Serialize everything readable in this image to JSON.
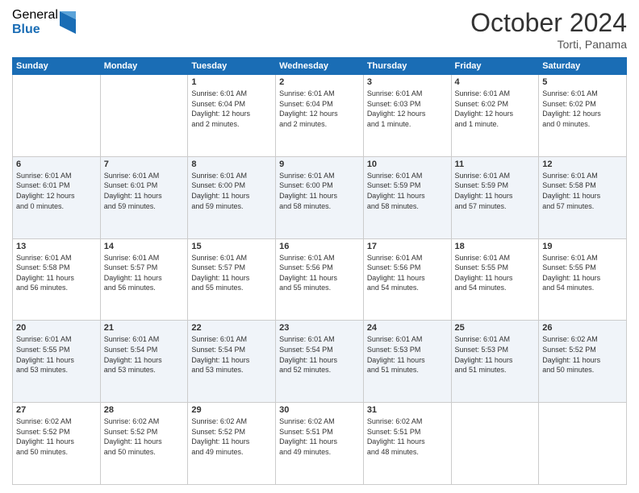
{
  "header": {
    "logo_general": "General",
    "logo_blue": "Blue",
    "month_title": "October 2024",
    "location": "Torti, Panama"
  },
  "days_of_week": [
    "Sunday",
    "Monday",
    "Tuesday",
    "Wednesday",
    "Thursday",
    "Friday",
    "Saturday"
  ],
  "weeks": [
    [
      {
        "day": "",
        "empty": true
      },
      {
        "day": "",
        "empty": true
      },
      {
        "day": "1",
        "info": "Sunrise: 6:01 AM\nSunset: 6:04 PM\nDaylight: 12 hours\nand 2 minutes."
      },
      {
        "day": "2",
        "info": "Sunrise: 6:01 AM\nSunset: 6:04 PM\nDaylight: 12 hours\nand 2 minutes."
      },
      {
        "day": "3",
        "info": "Sunrise: 6:01 AM\nSunset: 6:03 PM\nDaylight: 12 hours\nand 1 minute."
      },
      {
        "day": "4",
        "info": "Sunrise: 6:01 AM\nSunset: 6:02 PM\nDaylight: 12 hours\nand 1 minute."
      },
      {
        "day": "5",
        "info": "Sunrise: 6:01 AM\nSunset: 6:02 PM\nDaylight: 12 hours\nand 0 minutes."
      }
    ],
    [
      {
        "day": "6",
        "info": "Sunrise: 6:01 AM\nSunset: 6:01 PM\nDaylight: 12 hours\nand 0 minutes."
      },
      {
        "day": "7",
        "info": "Sunrise: 6:01 AM\nSunset: 6:01 PM\nDaylight: 11 hours\nand 59 minutes."
      },
      {
        "day": "8",
        "info": "Sunrise: 6:01 AM\nSunset: 6:00 PM\nDaylight: 11 hours\nand 59 minutes."
      },
      {
        "day": "9",
        "info": "Sunrise: 6:01 AM\nSunset: 6:00 PM\nDaylight: 11 hours\nand 58 minutes."
      },
      {
        "day": "10",
        "info": "Sunrise: 6:01 AM\nSunset: 5:59 PM\nDaylight: 11 hours\nand 58 minutes."
      },
      {
        "day": "11",
        "info": "Sunrise: 6:01 AM\nSunset: 5:59 PM\nDaylight: 11 hours\nand 57 minutes."
      },
      {
        "day": "12",
        "info": "Sunrise: 6:01 AM\nSunset: 5:58 PM\nDaylight: 11 hours\nand 57 minutes."
      }
    ],
    [
      {
        "day": "13",
        "info": "Sunrise: 6:01 AM\nSunset: 5:58 PM\nDaylight: 11 hours\nand 56 minutes."
      },
      {
        "day": "14",
        "info": "Sunrise: 6:01 AM\nSunset: 5:57 PM\nDaylight: 11 hours\nand 56 minutes."
      },
      {
        "day": "15",
        "info": "Sunrise: 6:01 AM\nSunset: 5:57 PM\nDaylight: 11 hours\nand 55 minutes."
      },
      {
        "day": "16",
        "info": "Sunrise: 6:01 AM\nSunset: 5:56 PM\nDaylight: 11 hours\nand 55 minutes."
      },
      {
        "day": "17",
        "info": "Sunrise: 6:01 AM\nSunset: 5:56 PM\nDaylight: 11 hours\nand 54 minutes."
      },
      {
        "day": "18",
        "info": "Sunrise: 6:01 AM\nSunset: 5:55 PM\nDaylight: 11 hours\nand 54 minutes."
      },
      {
        "day": "19",
        "info": "Sunrise: 6:01 AM\nSunset: 5:55 PM\nDaylight: 11 hours\nand 54 minutes."
      }
    ],
    [
      {
        "day": "20",
        "info": "Sunrise: 6:01 AM\nSunset: 5:55 PM\nDaylight: 11 hours\nand 53 minutes."
      },
      {
        "day": "21",
        "info": "Sunrise: 6:01 AM\nSunset: 5:54 PM\nDaylight: 11 hours\nand 53 minutes."
      },
      {
        "day": "22",
        "info": "Sunrise: 6:01 AM\nSunset: 5:54 PM\nDaylight: 11 hours\nand 53 minutes."
      },
      {
        "day": "23",
        "info": "Sunrise: 6:01 AM\nSunset: 5:54 PM\nDaylight: 11 hours\nand 52 minutes."
      },
      {
        "day": "24",
        "info": "Sunrise: 6:01 AM\nSunset: 5:53 PM\nDaylight: 11 hours\nand 51 minutes."
      },
      {
        "day": "25",
        "info": "Sunrise: 6:01 AM\nSunset: 5:53 PM\nDaylight: 11 hours\nand 51 minutes."
      },
      {
        "day": "26",
        "info": "Sunrise: 6:02 AM\nSunset: 5:52 PM\nDaylight: 11 hours\nand 50 minutes."
      }
    ],
    [
      {
        "day": "27",
        "info": "Sunrise: 6:02 AM\nSunset: 5:52 PM\nDaylight: 11 hours\nand 50 minutes."
      },
      {
        "day": "28",
        "info": "Sunrise: 6:02 AM\nSunset: 5:52 PM\nDaylight: 11 hours\nand 50 minutes."
      },
      {
        "day": "29",
        "info": "Sunrise: 6:02 AM\nSunset: 5:52 PM\nDaylight: 11 hours\nand 49 minutes."
      },
      {
        "day": "30",
        "info": "Sunrise: 6:02 AM\nSunset: 5:51 PM\nDaylight: 11 hours\nand 49 minutes."
      },
      {
        "day": "31",
        "info": "Sunrise: 6:02 AM\nSunset: 5:51 PM\nDaylight: 11 hours\nand 48 minutes."
      },
      {
        "day": "",
        "empty": true
      },
      {
        "day": "",
        "empty": true
      }
    ]
  ]
}
